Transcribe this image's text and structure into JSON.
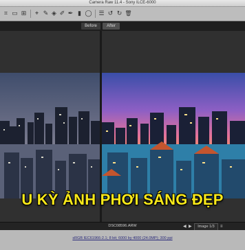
{
  "window": {
    "title": "Camera Raw 11.4  -  Sony ILCE-6000"
  },
  "toolbar": {
    "tools": [
      {
        "name": "crop-icon",
        "glyph": "⌗"
      },
      {
        "name": "straighten-icon",
        "glyph": "▭"
      },
      {
        "name": "transform-icon",
        "glyph": "⊞"
      },
      {
        "name": "spot-removal-icon",
        "glyph": "⌖"
      },
      {
        "name": "white-balance-icon",
        "glyph": "✎"
      },
      {
        "name": "color-sampler-icon",
        "glyph": "◈"
      },
      {
        "name": "red-eye-icon",
        "glyph": "✐"
      },
      {
        "name": "adjustment-brush-icon",
        "glyph": "✒"
      },
      {
        "name": "graduated-filter-icon",
        "glyph": "▮"
      },
      {
        "name": "radial-filter-icon",
        "glyph": "◯"
      },
      {
        "name": "preferences-icon",
        "glyph": "☰"
      },
      {
        "name": "rotate-left-icon",
        "glyph": "↺"
      },
      {
        "name": "rotate-right-icon",
        "glyph": "↻"
      },
      {
        "name": "trash-icon",
        "glyph": "🗑"
      }
    ]
  },
  "compare": {
    "before_label": "Before",
    "after_label": "After"
  },
  "banner": {
    "text": "U KỲ ẢNH PHƠI SÁNG ĐẸP",
    "color": "#f7e81a"
  },
  "status": {
    "filename": "DSC08596.ARW",
    "prev_glyph": "◀",
    "next_glyph": "▶",
    "image_counter": "Image 1/3",
    "settings_glyph": "≡"
  },
  "footer": {
    "workflow_link": "sRGB IEC61966-2.1; 8 bit; 6000 by 4000 (24.0MP); 300 ppi"
  },
  "colors": {
    "ui_dark": "#2a2a2a",
    "toolbar": "#bdbdbd",
    "banner_yellow": "#f7e81a"
  }
}
